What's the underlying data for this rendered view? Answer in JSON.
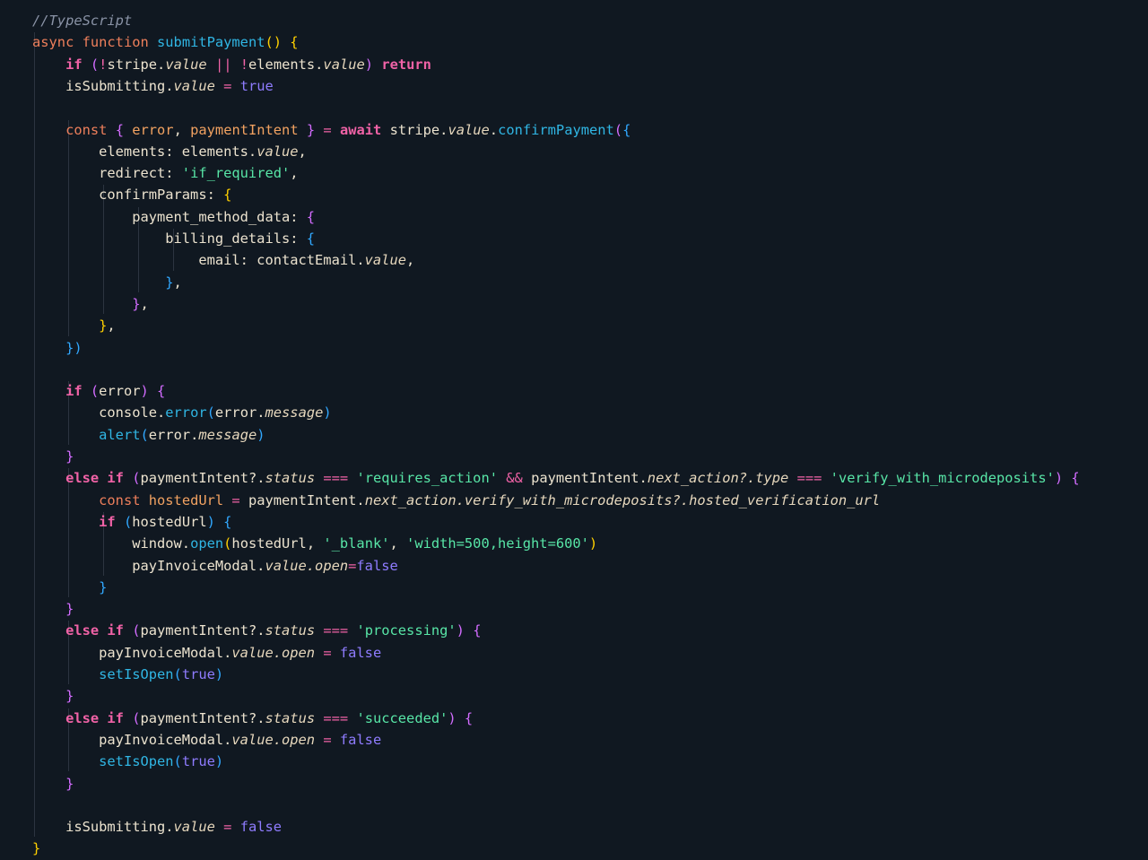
{
  "editor": {
    "language_comment": "//TypeScript",
    "lines": [
      [
        [
          "comment",
          "//TypeScript"
        ]
      ],
      [
        [
          "keyword",
          "async "
        ],
        [
          "keyword",
          "function "
        ],
        [
          "function",
          "submitPayment"
        ],
        [
          "brace1",
          "() {"
        ]
      ],
      [
        [
          "variable",
          "    "
        ],
        [
          "control",
          "if "
        ],
        [
          "brace2",
          "("
        ],
        [
          "operator",
          "!"
        ],
        [
          "variable",
          "stripe."
        ],
        [
          "property",
          "value"
        ],
        [
          "operator",
          " || !"
        ],
        [
          "variable",
          "elements."
        ],
        [
          "property",
          "value"
        ],
        [
          "brace2",
          ")"
        ],
        [
          "control",
          " return"
        ]
      ],
      [
        [
          "variable",
          "    isSubmitting."
        ],
        [
          "property",
          "value"
        ],
        [
          "operator",
          " = "
        ],
        [
          "boolean",
          "true"
        ]
      ],
      [
        [
          "variable",
          ""
        ]
      ],
      [
        [
          "variable",
          "    "
        ],
        [
          "keyword",
          "const "
        ],
        [
          "brace2",
          "{ "
        ],
        [
          "const",
          "error"
        ],
        [
          "punct",
          ", "
        ],
        [
          "const",
          "paymentIntent"
        ],
        [
          "brace2",
          " }"
        ],
        [
          "operator",
          " = "
        ],
        [
          "control",
          "await "
        ],
        [
          "variable",
          "stripe."
        ],
        [
          "property",
          "value"
        ],
        [
          "punct",
          "."
        ],
        [
          "function",
          "confirmPayment"
        ],
        [
          "brace2",
          "("
        ],
        [
          "brace3",
          "{"
        ]
      ],
      [
        [
          "variable",
          "        elements: elements."
        ],
        [
          "property",
          "value"
        ],
        [
          "punct",
          ","
        ]
      ],
      [
        [
          "variable",
          "        redirect: "
        ],
        [
          "string",
          "'if_required'"
        ],
        [
          "punct",
          ","
        ]
      ],
      [
        [
          "variable",
          "        confirmParams: "
        ],
        [
          "brace1",
          "{"
        ]
      ],
      [
        [
          "variable",
          "            payment_method_data: "
        ],
        [
          "brace2",
          "{"
        ]
      ],
      [
        [
          "variable",
          "                billing_details: "
        ],
        [
          "brace3",
          "{"
        ]
      ],
      [
        [
          "variable",
          "                    email: contactEmail."
        ],
        [
          "property",
          "value"
        ],
        [
          "punct",
          ","
        ]
      ],
      [
        [
          "variable",
          "                "
        ],
        [
          "brace3",
          "}"
        ],
        [
          "punct",
          ","
        ]
      ],
      [
        [
          "variable",
          "            "
        ],
        [
          "brace2",
          "}"
        ],
        [
          "punct",
          ","
        ]
      ],
      [
        [
          "variable",
          "        "
        ],
        [
          "brace1",
          "}"
        ],
        [
          "punct",
          ","
        ]
      ],
      [
        [
          "variable",
          "    "
        ],
        [
          "brace3",
          "})"
        ]
      ],
      [
        [
          "variable",
          ""
        ]
      ],
      [
        [
          "variable",
          "    "
        ],
        [
          "control",
          "if "
        ],
        [
          "brace2",
          "("
        ],
        [
          "variable",
          "error"
        ],
        [
          "brace2",
          ") {"
        ]
      ],
      [
        [
          "variable",
          "        console."
        ],
        [
          "function",
          "error"
        ],
        [
          "brace3",
          "("
        ],
        [
          "variable",
          "error."
        ],
        [
          "property",
          "message"
        ],
        [
          "brace3",
          ")"
        ]
      ],
      [
        [
          "variable",
          "        "
        ],
        [
          "function",
          "alert"
        ],
        [
          "brace3",
          "("
        ],
        [
          "variable",
          "error."
        ],
        [
          "property",
          "message"
        ],
        [
          "brace3",
          ")"
        ]
      ],
      [
        [
          "variable",
          "    "
        ],
        [
          "brace2",
          "}"
        ]
      ],
      [
        [
          "variable",
          "    "
        ],
        [
          "control",
          "else if "
        ],
        [
          "brace2",
          "("
        ],
        [
          "variable",
          "paymentIntent?."
        ],
        [
          "property",
          "status"
        ],
        [
          "operator",
          " === "
        ],
        [
          "string",
          "'requires_action'"
        ],
        [
          "operator",
          " && "
        ],
        [
          "variable",
          "paymentIntent."
        ],
        [
          "property",
          "next_action?.type"
        ],
        [
          "operator",
          " === "
        ],
        [
          "string",
          "'verify_with_microdeposits'"
        ],
        [
          "brace2",
          ") {"
        ]
      ],
      [
        [
          "variable",
          "        "
        ],
        [
          "keyword",
          "const "
        ],
        [
          "const",
          "hostedUrl"
        ],
        [
          "operator",
          " = "
        ],
        [
          "variable",
          "paymentIntent."
        ],
        [
          "property",
          "next_action.verify_with_microdeposits?.hosted_verification_url"
        ]
      ],
      [
        [
          "variable",
          "        "
        ],
        [
          "control",
          "if "
        ],
        [
          "brace3",
          "("
        ],
        [
          "variable",
          "hostedUrl"
        ],
        [
          "brace3",
          ") {"
        ]
      ],
      [
        [
          "variable",
          "            window."
        ],
        [
          "function",
          "open"
        ],
        [
          "brace1",
          "("
        ],
        [
          "variable",
          "hostedUrl, "
        ],
        [
          "string",
          "'_blank'"
        ],
        [
          "punct",
          ", "
        ],
        [
          "string",
          "'width=500,height=600'"
        ],
        [
          "brace1",
          ")"
        ]
      ],
      [
        [
          "variable",
          "            payInvoiceModal."
        ],
        [
          "property",
          "value.open"
        ],
        [
          "operator",
          "="
        ],
        [
          "boolean",
          "false"
        ]
      ],
      [
        [
          "variable",
          "        "
        ],
        [
          "brace3",
          "}"
        ]
      ],
      [
        [
          "variable",
          "    "
        ],
        [
          "brace2",
          "}"
        ]
      ],
      [
        [
          "variable",
          "    "
        ],
        [
          "control",
          "else if "
        ],
        [
          "brace2",
          "("
        ],
        [
          "variable",
          "paymentIntent?."
        ],
        [
          "property",
          "status"
        ],
        [
          "operator",
          " === "
        ],
        [
          "string",
          "'processing'"
        ],
        [
          "brace2",
          ") {"
        ]
      ],
      [
        [
          "variable",
          "        payInvoiceModal."
        ],
        [
          "property",
          "value.open"
        ],
        [
          "operator",
          " = "
        ],
        [
          "boolean",
          "false"
        ]
      ],
      [
        [
          "variable",
          "        "
        ],
        [
          "function",
          "setIsOpen"
        ],
        [
          "brace3",
          "("
        ],
        [
          "boolean",
          "true"
        ],
        [
          "brace3",
          ")"
        ]
      ],
      [
        [
          "variable",
          "    "
        ],
        [
          "brace2",
          "}"
        ]
      ],
      [
        [
          "variable",
          "    "
        ],
        [
          "control",
          "else if "
        ],
        [
          "brace2",
          "("
        ],
        [
          "variable",
          "paymentIntent?."
        ],
        [
          "property",
          "status"
        ],
        [
          "operator",
          " === "
        ],
        [
          "string",
          "'succeeded'"
        ],
        [
          "brace2",
          ") {"
        ]
      ],
      [
        [
          "variable",
          "        payInvoiceModal."
        ],
        [
          "property",
          "value.open"
        ],
        [
          "operator",
          " = "
        ],
        [
          "boolean",
          "false"
        ]
      ],
      [
        [
          "variable",
          "        "
        ],
        [
          "function",
          "setIsOpen"
        ],
        [
          "brace3",
          "("
        ],
        [
          "boolean",
          "true"
        ],
        [
          "brace3",
          ")"
        ]
      ],
      [
        [
          "variable",
          "    "
        ],
        [
          "brace2",
          "}"
        ]
      ],
      [
        [
          "variable",
          ""
        ]
      ],
      [
        [
          "variable",
          "    isSubmitting."
        ],
        [
          "property",
          "value"
        ],
        [
          "operator",
          " = "
        ],
        [
          "boolean",
          "false"
        ]
      ],
      [
        [
          "brace1",
          "}"
        ]
      ]
    ]
  }
}
